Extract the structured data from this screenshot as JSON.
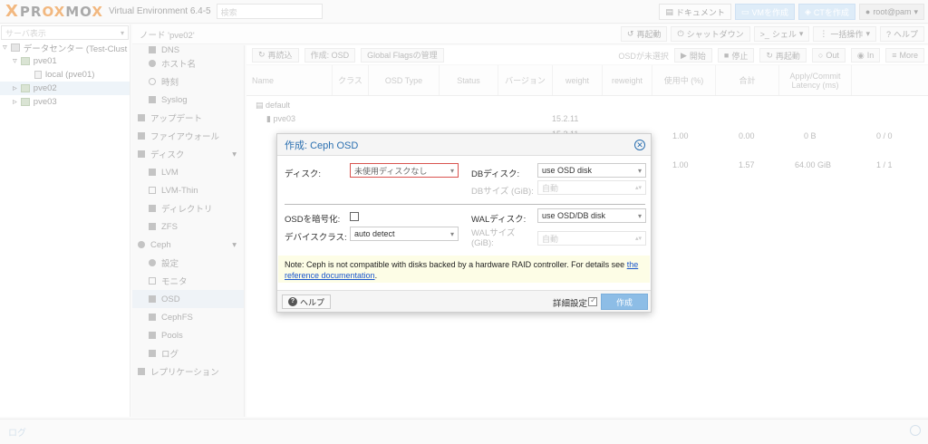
{
  "header": {
    "logo_x": "X",
    "logo_pro": "PR",
    "logo_ox": "OX",
    "logo_mo": "MO",
    "logo_x2": "X",
    "version": "Virtual Environment 6.4-5",
    "search_placeholder": "検索",
    "buttons": [
      "ドキュメント",
      "VMを作成",
      "CTを作成",
      "root@pam"
    ]
  },
  "tree": {
    "view_select": "サーバ表示",
    "items": [
      {
        "label": "データセンター (Test-Clust"
      },
      {
        "label": "pve01"
      },
      {
        "label": "local (pve01)"
      },
      {
        "label": "pve02"
      },
      {
        "label": "pve03"
      }
    ]
  },
  "topbar": {
    "title": "ノード 'pve02'",
    "buttons": [
      "再起動",
      "シャットダウン",
      "シェル",
      "一括操作",
      "ヘルプ"
    ]
  },
  "menu": {
    "items": [
      {
        "label": "DNS"
      },
      {
        "label": "ホスト名"
      },
      {
        "label": "時刻"
      },
      {
        "label": "Syslog"
      },
      {
        "label": "アップデート"
      },
      {
        "label": "ファイアウォール"
      },
      {
        "label": "ディスク"
      },
      {
        "label": "LVM"
      },
      {
        "label": "LVM-Thin"
      },
      {
        "label": "ディレクトリ"
      },
      {
        "label": "ZFS"
      },
      {
        "label": "Ceph"
      },
      {
        "label": "設定"
      },
      {
        "label": "モニタ"
      },
      {
        "label": "OSD"
      },
      {
        "label": "CephFS"
      },
      {
        "label": "Pools"
      },
      {
        "label": "ログ"
      },
      {
        "label": "レプリケーション"
      }
    ]
  },
  "main": {
    "toolbar": [
      "再読込",
      "作成: OSD",
      "Global Flagsの管理"
    ],
    "toolbar_right": [
      "OSDが未選択",
      "開始",
      "停止",
      "再起動",
      "Out",
      "In",
      "More"
    ],
    "columns": [
      "Name",
      "クラス",
      "OSD Type",
      "Status",
      "バージョン",
      "weight",
      "reweight",
      "使用中 (%)",
      "合計",
      "Apply/Commit Latency (ms)"
    ],
    "rows": [
      {
        "name": "default"
      },
      {
        "name": "pve03",
        "version": "15.2.11"
      },
      {
        "version": "15.2.11",
        "reweight": "1.00",
        "used": "0.00",
        "total": "0 B",
        "latency": "0 / 0"
      },
      {
        "reweight": "1.00",
        "used": "1.57",
        "total": "64.00 GiB",
        "latency": "1 / 1"
      }
    ]
  },
  "log": {
    "label": "ログ"
  },
  "dialog": {
    "title": "作成: Ceph OSD",
    "disk_label": "ディスク:",
    "disk_value": "未使用ディスクなし",
    "db_disk_label": "DBディスク:",
    "db_disk_value": "use OSD disk",
    "db_size_label": "DBサイズ (GiB):",
    "db_size_placeholder": "自動",
    "encrypt_label": "OSDを暗号化:",
    "device_class_label": "デバイスクラス:",
    "device_class_value": "auto detect",
    "wal_disk_label": "WALディスク:",
    "wal_disk_value": "use OSD/DB disk",
    "wal_size_label_1": "WALサイズ",
    "wal_size_label_2": "(GiB):",
    "wal_size_placeholder": "自動",
    "note_text": "Note: Ceph is not compatible with disks backed by a hardware RAID controller. For details see ",
    "note_link_1": "the",
    "note_link_2": "reference documentation",
    "note_end": ".",
    "help_label": "ヘルプ",
    "advanced_label": "詳細設定",
    "create_label": "作成"
  }
}
